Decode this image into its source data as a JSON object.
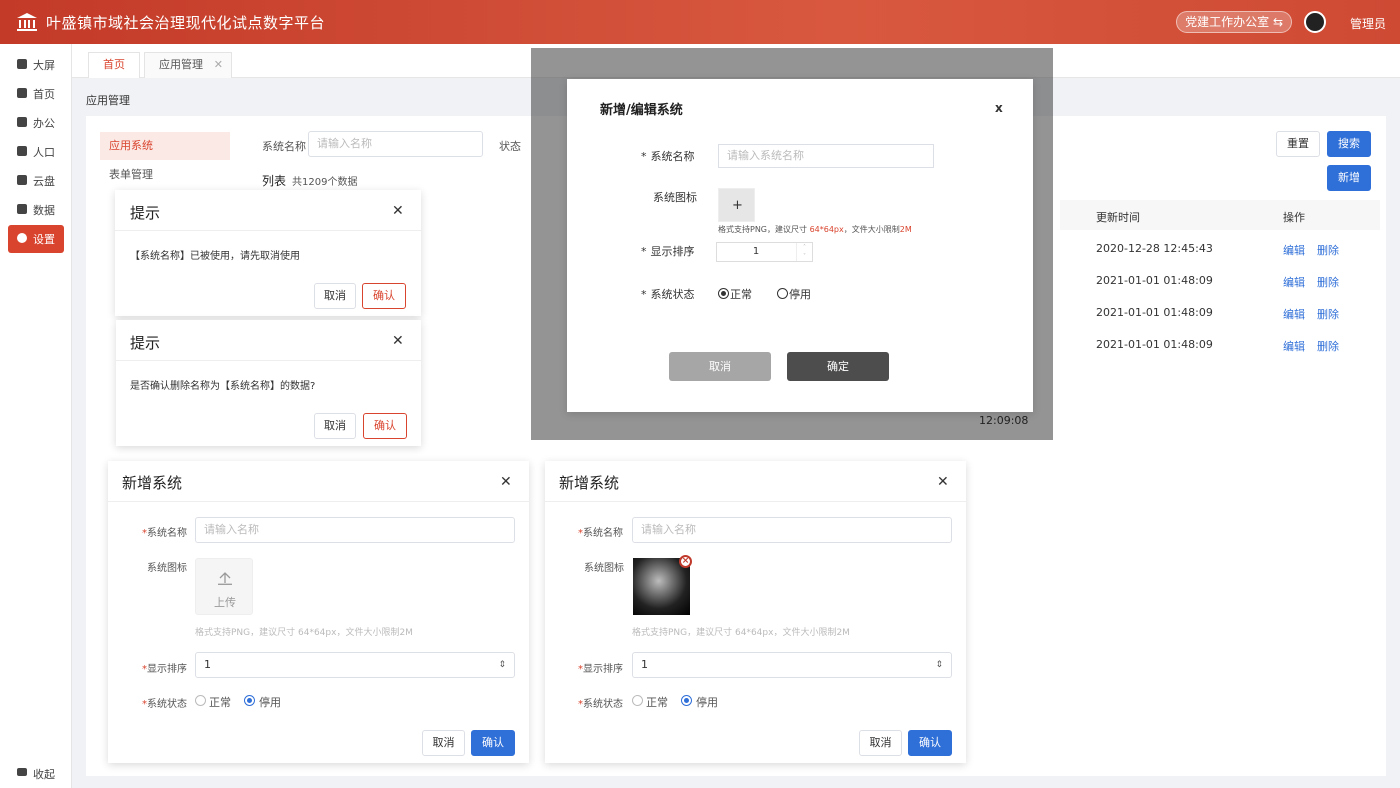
{
  "header": {
    "title": "叶盛镇市域社会治理现代化试点数字平台",
    "office": "党建工作办公室 ⇆",
    "user": "管理员"
  },
  "sidebar": {
    "items": [
      "大屏",
      "首页",
      "办公",
      "人口",
      "云盘",
      "数据",
      "设置"
    ],
    "collapse": "收起"
  },
  "tabs": {
    "home": "首页",
    "app": "应用管理"
  },
  "breadcrumb": "应用管理",
  "left_menu": [
    "应用系统",
    "表单管理"
  ],
  "filter": {
    "name_label": "系统名称",
    "name_placeholder": "请输入名称",
    "status_label": "状态",
    "reset": "重置",
    "search": "搜索",
    "add": "新增"
  },
  "list": {
    "title": "列表",
    "count": "共1209个数据"
  },
  "table": {
    "headers": {
      "updated": "更新时间",
      "ops": "操作"
    },
    "rows": [
      {
        "updated": "2020-12-28 12:45:43"
      },
      {
        "updated": "2021-01-01 01:48:09"
      },
      {
        "updated": "2021-01-01 01:48:09"
      },
      {
        "updated": "2021-01-01 01:48:09"
      }
    ],
    "edit": "编辑",
    "delete": "删除",
    "partial_time": "12:09:08"
  },
  "colors": {
    "brand_red": "#d9442e",
    "primary_blue": "#2f6fd8"
  },
  "edit_dialog": {
    "title": "新增/编辑系统",
    "close": "x",
    "name_label": "系统名称",
    "name_placeholder": "请输入系统名称",
    "icon_label": "系统图标",
    "upload_plus": "+",
    "hint_prefix": "格式支持PNG，建议尺寸 ",
    "hint_size": "64*64px",
    "hint_mid": "，文件大小限制",
    "hint_limit": "2M",
    "order_label": "显示排序",
    "order_value": "1",
    "status_label": "系统状态",
    "status_on": "正常",
    "status_off": "停用",
    "cancel": "取消",
    "ok": "确定"
  },
  "tip1": {
    "title": "提示",
    "message": "【系统名称】已被使用，请先取消使用",
    "cancel": "取消",
    "ok": "确认"
  },
  "tip2": {
    "title": "提示",
    "message": "是否确认删除名称为【系统名称】的数据?",
    "cancel": "取消",
    "ok": "确认"
  },
  "add_dialog_1": {
    "title": "新增系统",
    "name_label": "系统名称",
    "name_placeholder": "请输入名称",
    "icon_label": "系统图标",
    "upload": "上传",
    "hint": "格式支持PNG，建议尺寸 64*64px，文件大小限制2M",
    "order_label": "显示排序",
    "order_value": "1",
    "status_label": "系统状态",
    "status_on": "正常",
    "status_off": "停用",
    "cancel": "取消",
    "ok": "确认"
  },
  "add_dialog_2": {
    "title": "新增系统",
    "name_label": "系统名称",
    "name_placeholder": "请输入名称",
    "icon_label": "系统图标",
    "hint": "格式支持PNG，建议尺寸 64*64px，文件大小限制2M",
    "order_label": "显示排序",
    "order_value": "1",
    "status_label": "系统状态",
    "status_on": "正常",
    "status_off": "停用",
    "cancel": "取消",
    "ok": "确认"
  }
}
